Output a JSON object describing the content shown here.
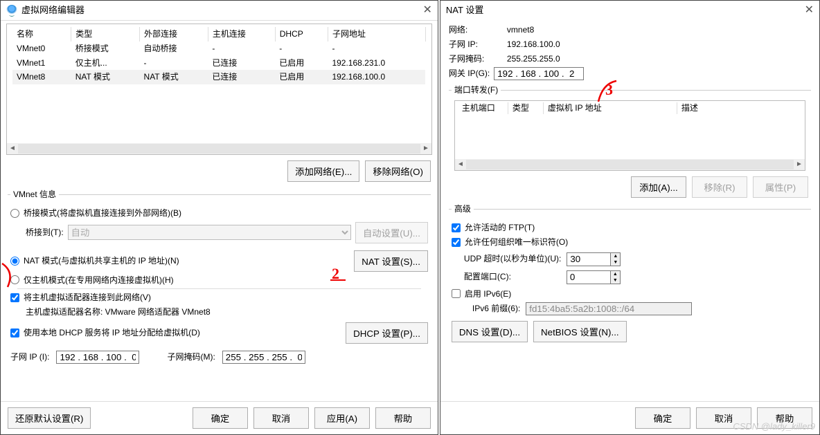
{
  "left": {
    "title": "虚拟网络编辑器",
    "cols": [
      "名称",
      "类型",
      "外部连接",
      "主机连接",
      "DHCP",
      "子网地址"
    ],
    "rows": [
      {
        "c": [
          "VMnet0",
          "桥接模式",
          "自动桥接",
          "-",
          "-",
          "-"
        ],
        "sel": false
      },
      {
        "c": [
          "VMnet1",
          "仅主机...",
          "-",
          "已连接",
          "已启用",
          "192.168.231.0"
        ],
        "sel": false
      },
      {
        "c": [
          "VMnet8",
          "NAT 模式",
          "NAT 模式",
          "已连接",
          "已启用",
          "192.168.100.0"
        ],
        "sel": true
      }
    ],
    "add_net": "添加网络(E)...",
    "remove_net": "移除网络(O)",
    "grp_title": "VMnet 信息",
    "mode_bridge": "桥接模式(将虚拟机直接连接到外部网络)(B)",
    "bridge_to_lbl": "桥接到(T):",
    "bridge_to_val": "自动",
    "bridge_auto": "自动设置(U)...",
    "mode_nat": "NAT 模式(与虚拟机共享主机的 IP 地址)(N)",
    "nat_btn": "NAT 设置(S)...",
    "mode_host": "仅主机模式(在专用网络内连接虚拟机)(H)",
    "chk_host_adapter": "将主机虚拟适配器连接到此网络(V)",
    "host_adapter_name": "主机虚拟适配器名称: VMware 网络适配器 VMnet8",
    "chk_dhcp": "使用本地 DHCP 服务将 IP 地址分配给虚拟机(D)",
    "dhcp_btn": "DHCP 设置(P)...",
    "subnet_ip_lbl": "子网 IP (I):",
    "subnet_ip": "192 . 168 . 100 .  0",
    "subnet_mask_lbl": "子网掩码(M):",
    "subnet_mask": "255 . 255 . 255 .  0",
    "restore": "还原默认设置(R)",
    "ok": "确定",
    "cancel": "取消",
    "apply": "应用(A)",
    "help": "帮助"
  },
  "right": {
    "title": "NAT 设置",
    "net_lbl": "网络:",
    "net": "vmnet8",
    "sub_ip_lbl": "子网 IP:",
    "sub_ip": "192.168.100.0",
    "sub_mask_lbl": "子网掩码:",
    "sub_mask": "255.255.255.0",
    "gw_lbl": "网关 IP(G):",
    "gw": "192 . 168 . 100 .  2",
    "pf_title": "端口转发(F)",
    "pf_cols": [
      "主机端口",
      "类型",
      "虚拟机 IP 地址",
      "描述"
    ],
    "add": "添加(A)...",
    "remove": "移除(R)",
    "props": "属性(P)",
    "adv_title": "高级",
    "chk_ftp": "允许活动的 FTP(T)",
    "chk_oui": "允许任何组织唯一标识符(O)",
    "udp_lbl": "UDP 超时(以秒为单位)(U):",
    "udp": "30",
    "cfgport_lbl": "配置端口(C):",
    "cfgport": "0",
    "chk_ipv6": "启用 IPv6(E)",
    "ipv6_lbl": "IPv6 前缀(6):",
    "ipv6": "fd15:4ba5:5a2b:1008::/64",
    "dns": "DNS 设置(D)...",
    "netbios": "NetBIOS 设置(N)...",
    "ok": "确定",
    "cancel": "取消",
    "help": "帮助"
  },
  "watermark": "CSDN @lady_killer9"
}
